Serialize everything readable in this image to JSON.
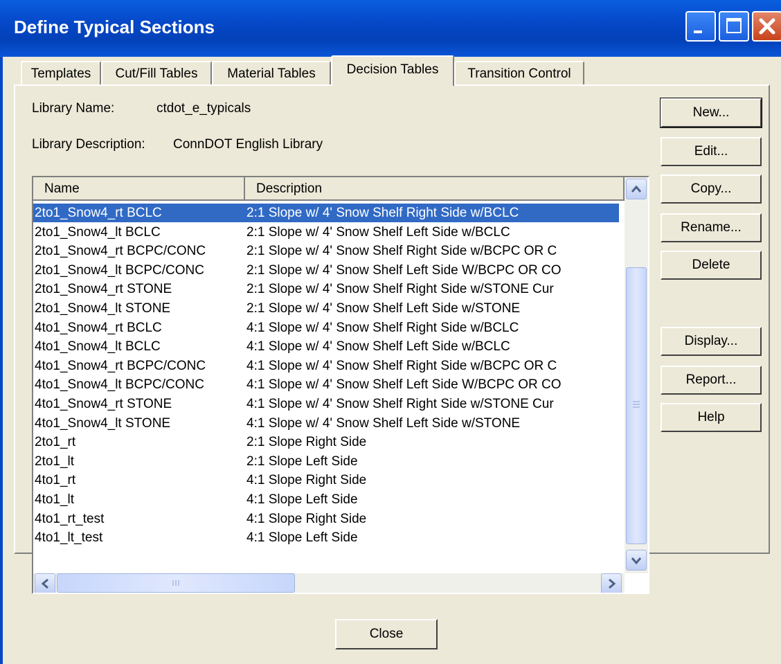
{
  "window": {
    "title": "Define Typical Sections"
  },
  "tabs": [
    "Templates",
    "Cut/Fill Tables",
    "Material Tables",
    "Decision Tables",
    "Transition Control"
  ],
  "active_tab": "Decision Tables",
  "library": {
    "name_label": "Library Name:",
    "name_value": "ctdot_e_typicals",
    "desc_label": "Library Description:",
    "desc_value": "ConnDOT English Library"
  },
  "table": {
    "columns": [
      "Name",
      "Description"
    ],
    "rows": [
      [
        "2to1_Snow4_rt BCLC",
        "2:1 Slope w/ 4' Snow Shelf Right Side w/BCLC"
      ],
      [
        "2to1_Snow4_lt BCLC",
        "2:1 Slope w/ 4' Snow Shelf Left Side w/BCLC"
      ],
      [
        "2to1_Snow4_rt BCPC/CONC",
        "2:1 Slope w/ 4' Snow Shelf Right Side w/BCPC OR C"
      ],
      [
        "2to1_Snow4_lt BCPC/CONC",
        "2:1 Slope w/ 4' Snow Shelf Left Side W/BCPC OR CO"
      ],
      [
        "2to1_Snow4_rt STONE",
        "2:1 Slope w/ 4' Snow Shelf Right Side w/STONE Cur"
      ],
      [
        "2to1_Snow4_lt STONE",
        "2:1 Slope w/ 4' Snow Shelf Left Side w/STONE"
      ],
      [
        "4to1_Snow4_rt BCLC",
        "4:1 Slope w/ 4' Snow Shelf Right Side w/BCLC"
      ],
      [
        "4to1_Snow4_lt BCLC",
        "4:1 Slope w/ 4' Snow Shelf Left Side w/BCLC"
      ],
      [
        "4to1_Snow4_rt BCPC/CONC",
        "4:1 Slope w/ 4' Snow Shelf Right Side w/BCPC OR C"
      ],
      [
        "4to1_Snow4_lt BCPC/CONC",
        "4:1 Slope w/ 4' Snow Shelf Left Side W/BCPC OR CO"
      ],
      [
        "4to1_Snow4_rt STONE",
        "4:1 Slope w/ 4' Snow Shelf Right Side w/STONE Cur"
      ],
      [
        "4to1_Snow4_lt STONE",
        "4:1 Slope w/ 4' Snow Shelf Left Side w/STONE"
      ],
      [
        "2to1_rt",
        "2:1 Slope Right Side"
      ],
      [
        "2to1_lt",
        "2:1 Slope Left Side"
      ],
      [
        "4to1_rt",
        "4:1 Slope Right Side"
      ],
      [
        "4to1_lt",
        "4:1 Slope Left Side"
      ],
      [
        "4to1_rt_test",
        "4:1 Slope Right Side"
      ],
      [
        "4to1_lt_test",
        "4:1 Slope Left Side"
      ]
    ],
    "selected_row": 0
  },
  "buttons": {
    "new": "New...",
    "edit": "Edit...",
    "copy": "Copy...",
    "rename": "Rename...",
    "delete": "Delete",
    "display": "Display...",
    "report": "Report...",
    "help": "Help",
    "close": "Close"
  },
  "colors": {
    "titlebar": "#0548c8",
    "selection": "#316ac5",
    "dialog_bg": "#ece9d8"
  }
}
